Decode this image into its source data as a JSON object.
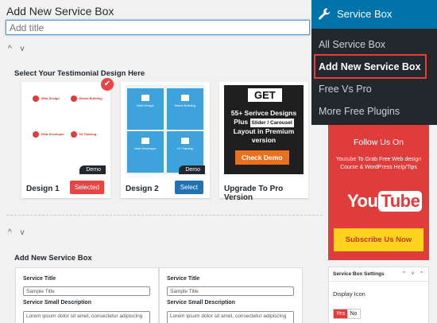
{
  "page": {
    "title": "Add New Service Box",
    "title_placeholder": "Add title"
  },
  "collapse_toggle": "^ v",
  "design_section": {
    "heading": "Select Your Testimonial Design Here",
    "cards": [
      {
        "label": "Design 1",
        "button": "Selected",
        "demo": "Demo"
      },
      {
        "label": "Design 2",
        "button": "Select",
        "demo": "Demo"
      },
      {
        "label": "Upgrade To Pro Version"
      }
    ],
    "thumb1_items": [
      "Web Design",
      "Brand Building",
      "Web Developer",
      "Hr Training"
    ],
    "thumb2_items": [
      "Web Design",
      "Brand Building",
      "Web Developer",
      "Hr Training"
    ],
    "promo": {
      "get": "GET",
      "line1": "55+ Serivce Designs",
      "plus": "Plus",
      "slider": "Slider / Carousel",
      "line3": "Layout in Premium",
      "line4": "version",
      "cta": "Check Demo"
    }
  },
  "add_service": {
    "heading": "Add New Service Box",
    "boxes": [
      {
        "title_label": "Service Title",
        "title_placeholder": "Sample Title",
        "desc_label": "Service Small Description",
        "desc_value": "Lorem ipsum dolor sit amet, consectetur adipiscing"
      },
      {
        "title_label": "Service Title",
        "title_placeholder": "Sample Title",
        "desc_label": "Service Small Description",
        "desc_value": "Lorem ipsum dolor sit amet, consectetur adipiscing"
      }
    ]
  },
  "menu": {
    "title": "Service Box",
    "items": [
      "All Service Box",
      "Add New Service Box",
      "Free Vs Pro",
      "More Free Plugins"
    ],
    "active_index": 1,
    "header_color": "#0073aa",
    "highlight_color": "#e53c3c"
  },
  "promo_panel": {
    "follow": "Follow Us On",
    "desc": "Youtube To Grab Free Web design Course & WordPress Help/Tips",
    "logo_you": "You",
    "logo_tube": "Tube",
    "subscribe": "Subscribe Us Now"
  },
  "settings": {
    "heading": "Service Box Settings",
    "controls": "^ v ^",
    "display_icon_label": "Display Icon",
    "yes": "Yes",
    "no": "No",
    "value": "Yes"
  }
}
